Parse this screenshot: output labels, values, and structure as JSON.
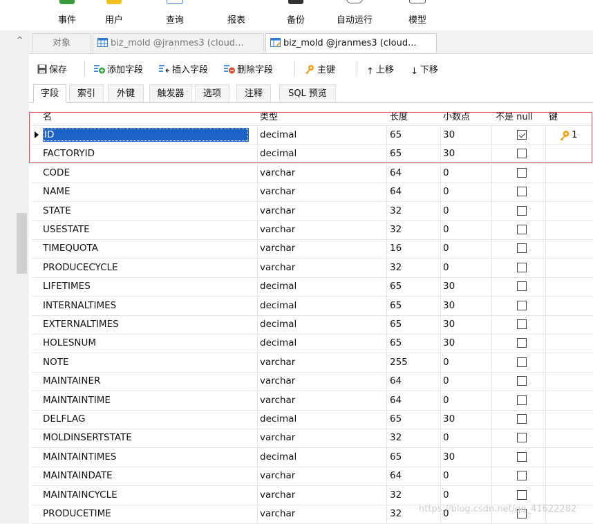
{
  "top_toolbar": {
    "items": [
      {
        "label": "事件",
        "icon": "event-icon"
      },
      {
        "label": "用户",
        "icon": "user-icon"
      },
      {
        "label": "查询",
        "icon": "query-icon"
      },
      {
        "label": "报表",
        "icon": "report-icon"
      },
      {
        "label": "备份",
        "icon": "backup-icon"
      },
      {
        "label": "自动运行",
        "icon": "automation-icon"
      },
      {
        "label": "模型",
        "icon": "model-icon"
      }
    ]
  },
  "tabs": [
    {
      "label": "对象",
      "state": "inactive"
    },
    {
      "label": "biz_mold @jranmes3 (cloud...",
      "state": "inactive",
      "icon": "table-icon"
    },
    {
      "label": "biz_mold @jranmes3 (cloud...",
      "state": "active",
      "icon": "design-table-icon"
    }
  ],
  "actions": {
    "save": "保存",
    "add_field": "添加字段",
    "insert_field": "插入字段",
    "delete_field": "删除字段",
    "primary_key": "主键",
    "move_up": "上移",
    "move_down": "下移"
  },
  "subtabs": [
    "字段",
    "索引",
    "外键",
    "触发器",
    "选项",
    "注释",
    "SQL 预览"
  ],
  "grid": {
    "columns": [
      "名",
      "类型",
      "长度",
      "小数点",
      "不是 null",
      "键"
    ],
    "rows": [
      {
        "name": "ID",
        "type": "decimal",
        "length": "65",
        "decimals": "30",
        "not_null": true,
        "key": "1",
        "selected": true
      },
      {
        "name": "FACTORYID",
        "type": "decimal",
        "length": "65",
        "decimals": "30",
        "not_null": false,
        "key": ""
      },
      {
        "name": "CODE",
        "type": "varchar",
        "length": "64",
        "decimals": "0",
        "not_null": false,
        "key": ""
      },
      {
        "name": "NAME",
        "type": "varchar",
        "length": "64",
        "decimals": "0",
        "not_null": false,
        "key": ""
      },
      {
        "name": "STATE",
        "type": "varchar",
        "length": "32",
        "decimals": "0",
        "not_null": false,
        "key": ""
      },
      {
        "name": "USESTATE",
        "type": "varchar",
        "length": "32",
        "decimals": "0",
        "not_null": false,
        "key": ""
      },
      {
        "name": "TIMEQUOTA",
        "type": "varchar",
        "length": "16",
        "decimals": "0",
        "not_null": false,
        "key": ""
      },
      {
        "name": "PRODUCECYCLE",
        "type": "varchar",
        "length": "32",
        "decimals": "0",
        "not_null": false,
        "key": ""
      },
      {
        "name": "LIFETIMES",
        "type": "decimal",
        "length": "65",
        "decimals": "30",
        "not_null": false,
        "key": ""
      },
      {
        "name": "INTERNALTIMES",
        "type": "decimal",
        "length": "65",
        "decimals": "30",
        "not_null": false,
        "key": ""
      },
      {
        "name": "EXTERNALTIMES",
        "type": "decimal",
        "length": "65",
        "decimals": "30",
        "not_null": false,
        "key": ""
      },
      {
        "name": "HOLESNUM",
        "type": "decimal",
        "length": "65",
        "decimals": "30",
        "not_null": false,
        "key": ""
      },
      {
        "name": "NOTE",
        "type": "varchar",
        "length": "255",
        "decimals": "0",
        "not_null": false,
        "key": ""
      },
      {
        "name": "MAINTAINER",
        "type": "varchar",
        "length": "64",
        "decimals": "0",
        "not_null": false,
        "key": ""
      },
      {
        "name": "MAINTAINTIME",
        "type": "varchar",
        "length": "64",
        "decimals": "0",
        "not_null": false,
        "key": ""
      },
      {
        "name": "DELFLAG",
        "type": "decimal",
        "length": "65",
        "decimals": "30",
        "not_null": false,
        "key": ""
      },
      {
        "name": "MOLDINSERTSTATE",
        "type": "varchar",
        "length": "32",
        "decimals": "0",
        "not_null": false,
        "key": ""
      },
      {
        "name": "MAINTAINTIMES",
        "type": "decimal",
        "length": "65",
        "decimals": "30",
        "not_null": false,
        "key": ""
      },
      {
        "name": "MAINTAINDATE",
        "type": "varchar",
        "length": "64",
        "decimals": "0",
        "not_null": false,
        "key": ""
      },
      {
        "name": "MAINTAINCYCLE",
        "type": "varchar",
        "length": "32",
        "decimals": "0",
        "not_null": false,
        "key": ""
      },
      {
        "name": "PRODUCETIME",
        "type": "varchar",
        "length": "32",
        "decimals": "0",
        "not_null": false,
        "key": ""
      }
    ]
  },
  "watermark": "https://blog.csdn.net/qq_41622282",
  "colors": {
    "selection": "#1d63c7",
    "highlight_border": "#e0505a",
    "key_icon": "#e8a21c",
    "add_icon": "#2a9d3a",
    "delete_icon": "#e04a2a"
  }
}
